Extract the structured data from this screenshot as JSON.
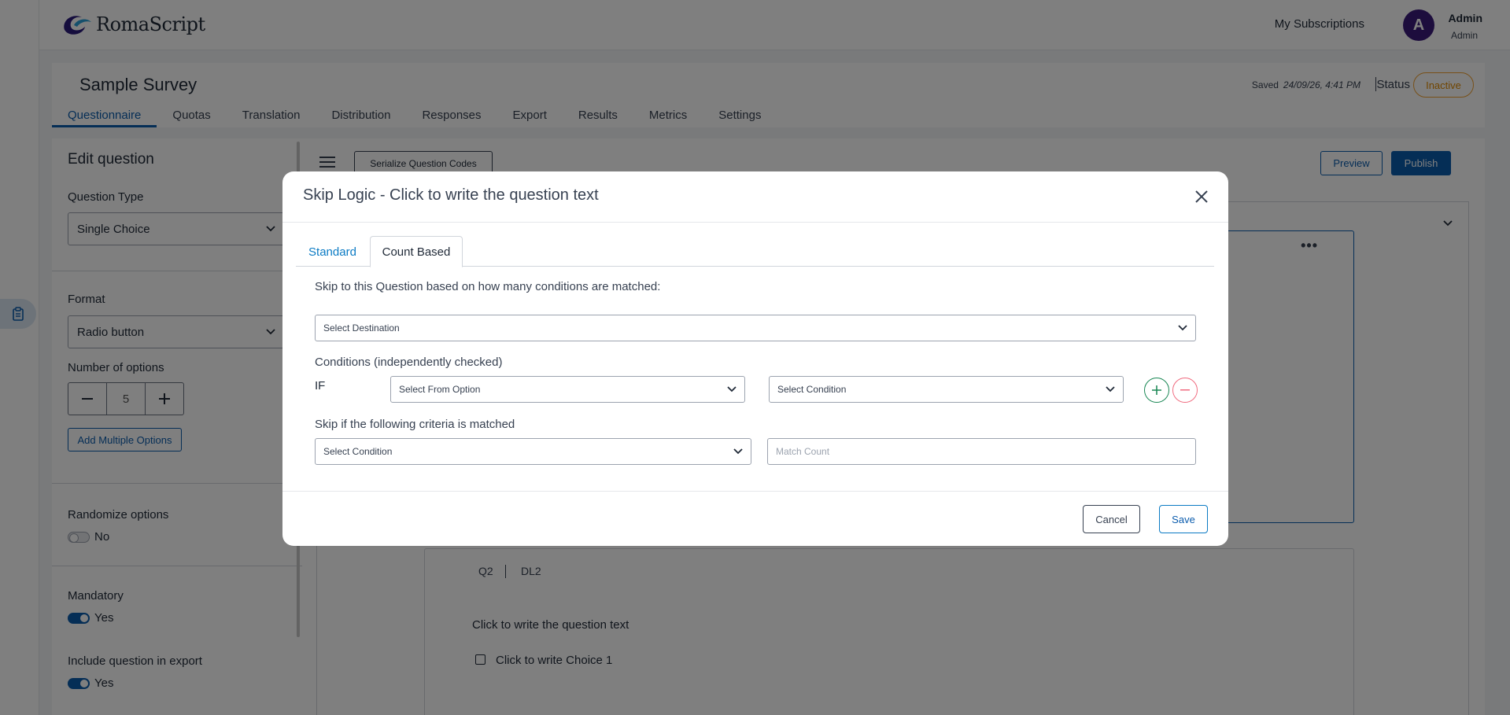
{
  "app": {
    "brand": "RomaScript",
    "my_subscriptions": "My Subscriptions",
    "user_initial": "A",
    "user_name": "Admin",
    "user_role": "Admin"
  },
  "survey": {
    "title": "Sample Survey",
    "saved_label": "Saved",
    "saved_time": "24/09/26, 4:41 PM",
    "status_label": "Status",
    "status_value": "Inactive",
    "tabs": [
      "Questionnaire",
      "Quotas",
      "Translation",
      "Distribution",
      "Responses",
      "Export",
      "Results",
      "Metrics",
      "Settings"
    ]
  },
  "edit_panel": {
    "title": "Edit question",
    "question_type_label": "Question Type",
    "question_type_value": "Single Choice",
    "format_label": "Format",
    "format_value": "Radio button",
    "num_options_label": "Number of options",
    "num_options_value": "5",
    "add_multiple_label": "Add Multiple Options",
    "randomize_label": "Randomize options",
    "randomize_value": "No",
    "mandatory_label": "Mandatory",
    "mandatory_value": "Yes",
    "include_export_label": "Include question in export",
    "include_export_value": "Yes"
  },
  "toolbar": {
    "serialize_label": "Serialize Question Codes",
    "preview_label": "Preview",
    "publish_label": "Publish"
  },
  "question2": {
    "id": "Q2",
    "code": "DL2",
    "text": "Click to write the question text",
    "choice1": "Click to write Choice 1"
  },
  "modal": {
    "title": "Skip Logic - Click to write the question text",
    "tab_standard": "Standard",
    "tab_count_based": "Count Based",
    "intro": "Skip to this Question based on how many conditions are matched:",
    "destination_placeholder": "Select Destination",
    "conditions_label": "Conditions (independently checked)",
    "if_label": "IF",
    "from_option_placeholder": "Select From Option",
    "condition_placeholder": "Select Condition",
    "criteria_label": "Skip if the following criteria is matched",
    "criteria_condition_placeholder": "Select Condition",
    "match_count_placeholder": "Match Count",
    "cancel_label": "Cancel",
    "save_label": "Save"
  },
  "colors": {
    "primary": "#0b5cad",
    "status_inactive": "#e08a00",
    "add_green": "#198754",
    "remove_red": "#f06b7f",
    "avatar": "#3a1a7a"
  }
}
